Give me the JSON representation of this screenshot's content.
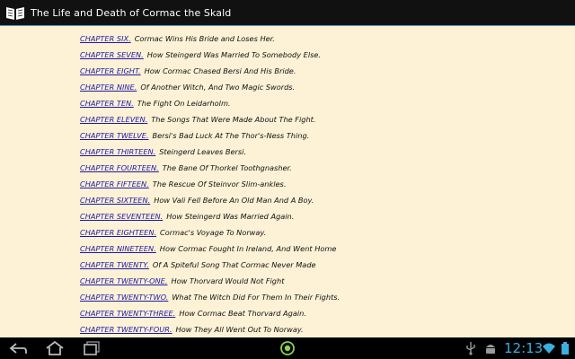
{
  "app": {
    "title": "The Life and Death of Cormac the Skald",
    "icon": "open-book-icon"
  },
  "toc": [
    {
      "chapter": "CHAPTER SIX.",
      "title": "Cormac Wins His Bride and Loses Her."
    },
    {
      "chapter": "CHAPTER SEVEN.",
      "title": "How Steingerd Was Married To Somebody Else."
    },
    {
      "chapter": "CHAPTER EIGHT.",
      "title": "How Cormac Chased Bersi And His Bride."
    },
    {
      "chapter": "CHAPTER NINE.",
      "title": "Of Another Witch, And Two Magic Swords."
    },
    {
      "chapter": "CHAPTER TEN.",
      "title": "The Fight On Leidarholm."
    },
    {
      "chapter": "CHAPTER ELEVEN.",
      "title": "The Songs That Were Made About The Fight."
    },
    {
      "chapter": "CHAPTER TWELVE.",
      "title": "Bersi's Bad Luck At The Thor's-Ness Thing."
    },
    {
      "chapter": "CHAPTER THIRTEEN.",
      "title": "Steingerd Leaves Bersi."
    },
    {
      "chapter": "CHAPTER FOURTEEN.",
      "title": "The Bane Of Thorkel Toothgnasher."
    },
    {
      "chapter": "CHAPTER FIFTEEN.",
      "title": "The Rescue Of Steinvor Slim-ankles."
    },
    {
      "chapter": "CHAPTER SIXTEEN.",
      "title": "How Vali Fell Before An Old Man And A Boy."
    },
    {
      "chapter": "CHAPTER SEVENTEEN.",
      "title": "How Steingerd Was Married Again."
    },
    {
      "chapter": "CHAPTER EIGHTEEN.",
      "title": "Cormac's Voyage To Norway."
    },
    {
      "chapter": "CHAPTER NINETEEN.",
      "title": "How Cormac Fought In Ireland, And Went Home"
    },
    {
      "chapter": "CHAPTER TWENTY.",
      "title": "Of A Spiteful Song That Cormac Never Made"
    },
    {
      "chapter": "CHAPTER TWENTY-ONE.",
      "title": "How Thorvard Would Not Fight"
    },
    {
      "chapter": "CHAPTER TWENTY-TWO.",
      "title": "What The Witch Did For Them In Their Fights."
    },
    {
      "chapter": "CHAPTER TWENTY-THREE.",
      "title": "How Cormac Beat Thorvard Again."
    },
    {
      "chapter": "CHAPTER TWENTY-FOUR.",
      "title": "How They All Went Out To Norway."
    }
  ],
  "system_bar": {
    "time": "12:13",
    "nav_icons": [
      "back-icon",
      "home-icon",
      "recent-apps-icon"
    ],
    "status_icons": [
      "usb-icon",
      "android-debug-icon",
      "wifi-icon",
      "battery-icon"
    ]
  },
  "colors": {
    "page_background": "#FDF1D6",
    "link": "#1a1aa8",
    "clock": "#38b0e0",
    "app_bar": "#111111"
  }
}
